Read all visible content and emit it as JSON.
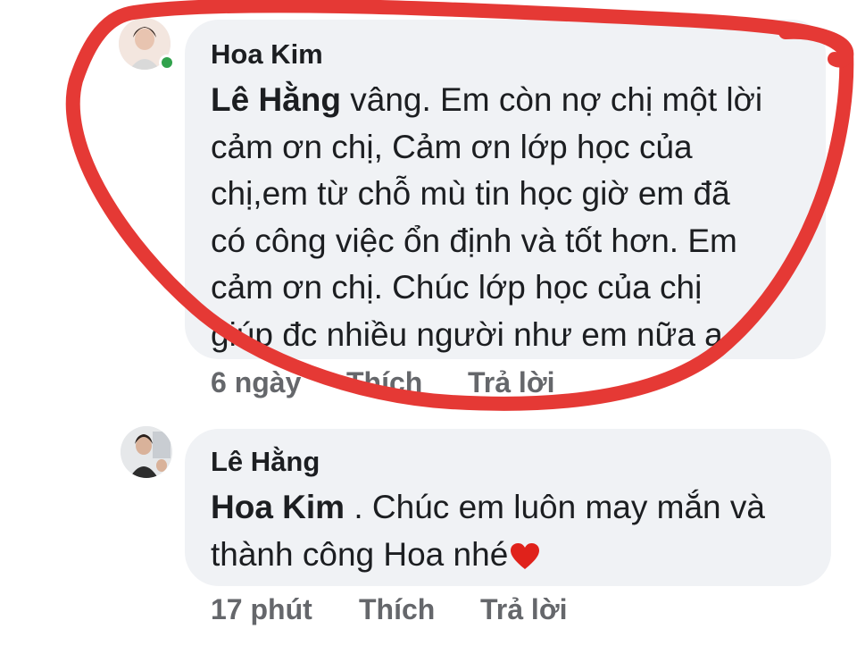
{
  "comments": [
    {
      "author": "Hoa Kim",
      "avatar_icon": "user-avatar-icon",
      "online": true,
      "mention": "Lê Hằng",
      "lines": [
        " vâng. Em còn nợ chị một lời",
        "cảm ơn chị, Cảm ơn lớp học của",
        "chị,em từ chỗ mù tin học giờ em đã",
        "có công việc ổn định và tốt hơn. Em",
        "cảm ơn chị. Chúc lớp học của chị",
        "giúp đc nhiều người như em nữa ạ."
      ],
      "time": "6 ngày",
      "like": "Thích",
      "reply": "Trả lời"
    },
    {
      "author": "Lê Hằng",
      "avatar_icon": "user-avatar-icon",
      "online": false,
      "mention": "Hoa Kim",
      "lines": [
        " . Chúc em luôn may mắn và",
        "thành công Hoa nhé"
      ],
      "emoji": "heart-icon",
      "time": "17 phút",
      "like": "Thích",
      "reply": "Trả lời"
    }
  ],
  "colors": {
    "bubble": "#f0f2f5",
    "text": "#1c1e21",
    "meta": "#65676b",
    "online": "#31a24c",
    "highlight_marker": "#e53935",
    "heart": "#e0221b"
  }
}
